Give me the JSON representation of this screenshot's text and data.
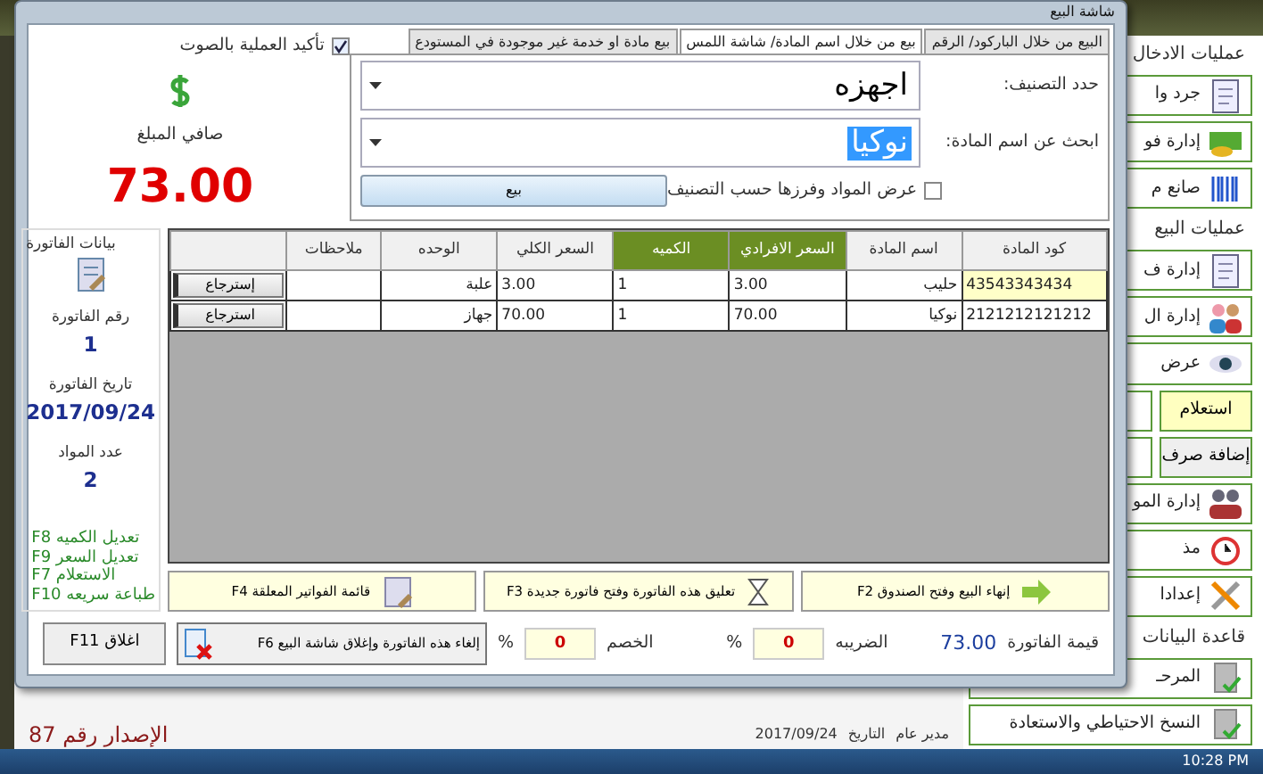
{
  "background_app": {
    "sidebar": [
      {
        "kind": "heading",
        "label": "عمليات الادخال"
      },
      {
        "kind": "tile",
        "label": "جرد وا",
        "highlighted": false
      },
      {
        "kind": "tile",
        "label": "إدارة فو",
        "highlighted": false
      },
      {
        "kind": "tile",
        "label": "صانع م",
        "highlighted": false
      },
      {
        "kind": "heading",
        "label": "عمليات البيع"
      },
      {
        "kind": "tile",
        "label": "إدارة ف",
        "highlighted": false
      },
      {
        "kind": "tile",
        "label": "إدارة ال",
        "highlighted": false
      },
      {
        "kind": "tile",
        "label": "عرض",
        "highlighted": false
      },
      {
        "kind": "button",
        "label": "استعلام",
        "highlighted": true
      },
      {
        "kind": "button",
        "label": "إضافة صرف",
        "highlighted": false
      },
      {
        "kind": "tile",
        "label": "إدارة المو",
        "highlighted": false
      },
      {
        "kind": "tile",
        "label": "مذ",
        "highlighted": false
      },
      {
        "kind": "tile",
        "label": "إعدادا",
        "highlighted": false
      },
      {
        "kind": "heading",
        "label": "قاعدة البيانات"
      },
      {
        "kind": "tile",
        "label": "المرحـ",
        "highlighted": false
      },
      {
        "kind": "tile",
        "label": "النسخ الاحتياطي والاستعادة",
        "highlighted": false
      }
    ],
    "version": "الإصدار رقم 87",
    "status_bar": {
      "user": "مدير عام",
      "date_label": "التاريخ",
      "date": "2017/09/24"
    },
    "taskbar": {
      "clock": "10:28 PM"
    }
  },
  "dialog": {
    "title": "شاشة البيع",
    "sound_confirm": {
      "label": "تأكيد العملية بالصوت",
      "checked": true
    },
    "net_amount": {
      "label": "صافي المبلغ",
      "value": "73.00"
    },
    "tabs": [
      {
        "label": "البيع من خلال الباركود/ الرقم",
        "selected": false
      },
      {
        "label": "بيع من خلال اسم المادة/ شاشة اللمس",
        "selected": true
      },
      {
        "label": "بيع مادة او خدمة غير موجودة في المستودع",
        "selected": false
      }
    ],
    "category": {
      "label": "حدد التصنيف:",
      "value": "اجهزه",
      "text_selected": false
    },
    "item_search": {
      "label": "ابحث عن اسم المادة:",
      "value": "نوكيا",
      "text_selected": true
    },
    "filter_by_category": {
      "label": "عرض المواد وفرزها حسب التصنيف",
      "checked": false
    },
    "sell_button": "بيع",
    "invoice_info": {
      "title": "بيانات الفاتورة",
      "number_label": "رقم الفاتورة",
      "number": "1",
      "date_label": "تاريخ الفاتورة",
      "date": "2017/09/24",
      "count_label": "عدد المواد",
      "count": "2",
      "shortcuts": [
        "تعديل الكميه F8",
        "تعديل السعر F9",
        "الاستعلام F7",
        "طباعة سريعه F10"
      ]
    },
    "table": {
      "columns": [
        {
          "label": "كود المادة",
          "highlighted": false
        },
        {
          "label": "اسم المادة",
          "highlighted": false
        },
        {
          "label": "السعر الافرادي",
          "highlighted": true
        },
        {
          "label": "الكميه",
          "highlighted": true
        },
        {
          "label": "السعر الكلي",
          "highlighted": false
        },
        {
          "label": "الوحده",
          "highlighted": false
        },
        {
          "label": "ملاحظات",
          "highlighted": false
        }
      ],
      "rows": [
        {
          "code": "43543343434",
          "name": "حليب",
          "unit_price": "3.00",
          "quantity": "1",
          "total": "3.00",
          "unit": "علبة",
          "action": "إسترجاع",
          "selected": true
        },
        {
          "code": "2121212121212",
          "name": "نوكيا",
          "unit_price": "70.00",
          "quantity": "1",
          "total": "70.00",
          "unit": "جهاز",
          "action": "استرجاع",
          "selected": false
        }
      ]
    },
    "actions": [
      "إنهاء البيع وفتح الصندوق F2",
      "تعليق هذه الفاتورة وفتح فاتورة جديدة F3",
      "قائمة الفواتير المعلقة F4"
    ],
    "totals": {
      "invoice_label": "قيمة الفاتورة",
      "invoice_value": "73.00",
      "tax_label": "الضريبه",
      "tax_value": "0",
      "tax_unit": "%",
      "discount_label": "الخصم",
      "discount_value": "0",
      "discount_unit": "%"
    },
    "cancel_button": "إلغاء هذه الفاتورة وإغلاق شاشة البيع F6",
    "close_button": "اغلاق F11"
  }
}
